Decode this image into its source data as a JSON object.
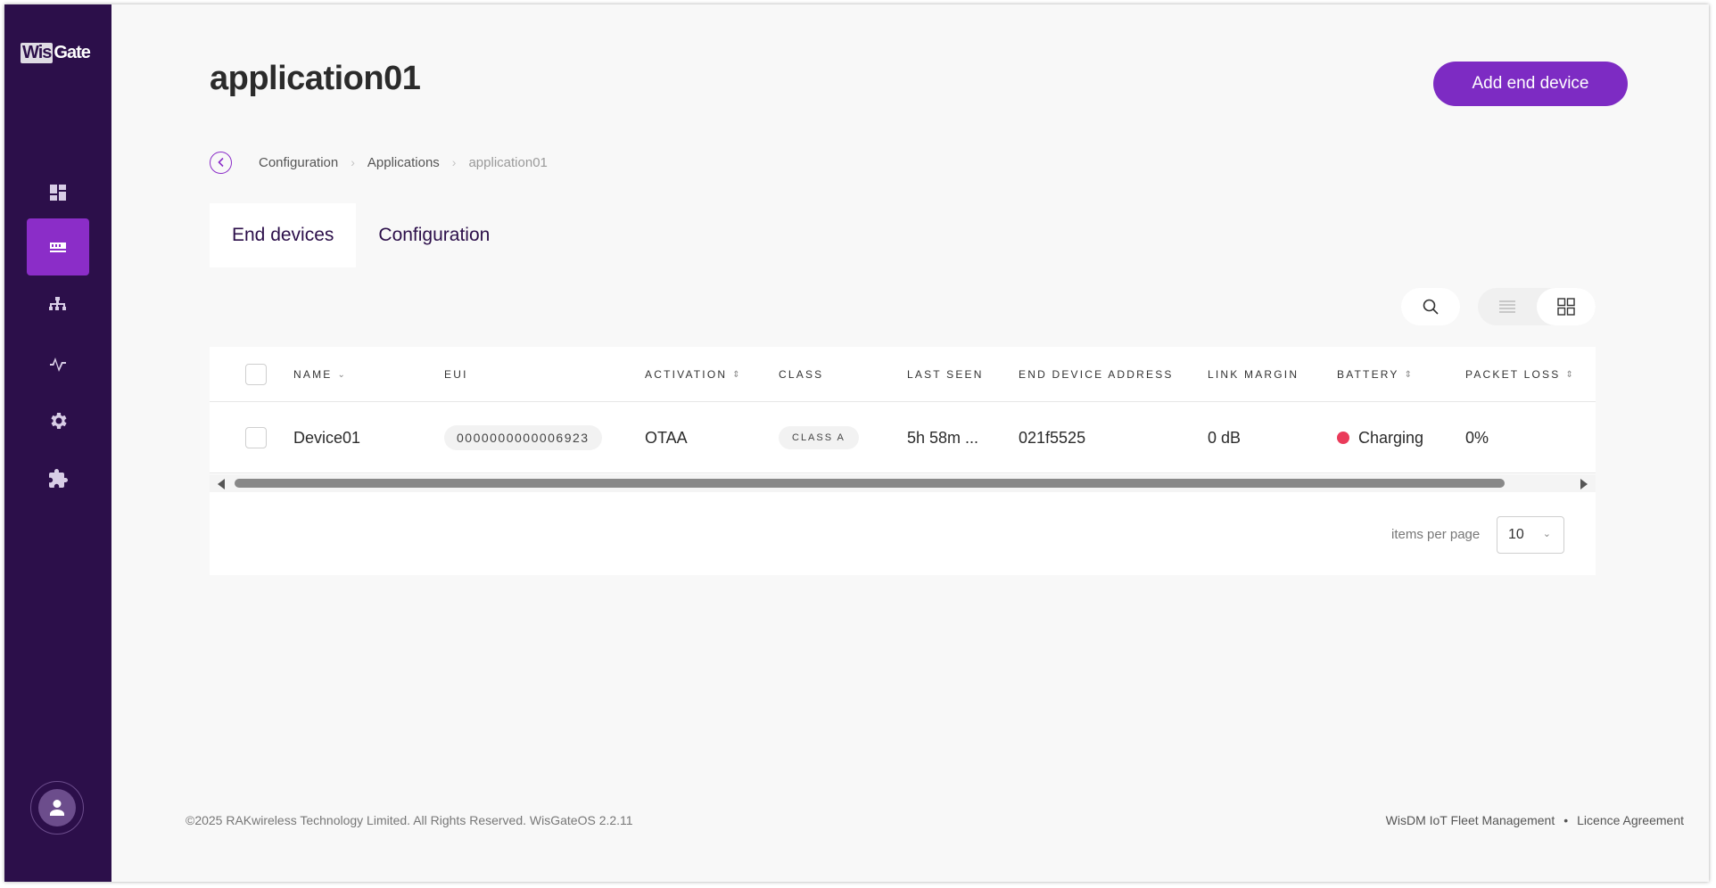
{
  "app": {
    "logo_part1": "Wis",
    "logo_part2": "Gate"
  },
  "sidebar": {
    "items": [
      {
        "icon": "dashboard-icon",
        "active": false
      },
      {
        "icon": "devices-icon",
        "active": true
      },
      {
        "icon": "network-icon",
        "active": false
      },
      {
        "icon": "activity-icon",
        "active": false
      },
      {
        "icon": "gear-icon",
        "active": false
      },
      {
        "icon": "puzzle-icon",
        "active": false
      }
    ],
    "avatar_icon": "user-icon"
  },
  "header": {
    "title": "application01",
    "add_button_label": "Add end device"
  },
  "breadcrumb": {
    "items": [
      "Configuration",
      "Applications",
      "application01"
    ]
  },
  "tabs": [
    {
      "label": "End devices",
      "active": true
    },
    {
      "label": "Configuration",
      "active": false
    }
  ],
  "table": {
    "columns": {
      "name": "NAME",
      "eui": "EUI",
      "activation": "ACTIVATION",
      "class": "CLASS",
      "last_seen": "LAST SEEN",
      "address": "END DEVICE ADDRESS",
      "link_margin": "LINK MARGIN",
      "battery": "BATTERY",
      "packet_loss": "PACKET LOSS"
    },
    "rows": [
      {
        "name": "Device01",
        "eui": "0000000000006923",
        "activation": "OTAA",
        "class": "CLASS A",
        "last_seen": "5h 58m ...",
        "address": "021f5525",
        "link_margin": "0 dB",
        "battery": "Charging",
        "battery_color": "#ea3b5a",
        "packet_loss": "0%"
      }
    ]
  },
  "pagination": {
    "label": "items per page",
    "value": "10"
  },
  "footer": {
    "copyright": "©2025 RAKwireless Technology Limited. All Rights Reserved. WisGateOS 2.2.11",
    "link1": "WisDM IoT Fleet Management",
    "separator": "•",
    "link2": "Licence Agreement"
  },
  "colors": {
    "sidebar_bg": "#2c0f4a",
    "accent": "#7d2bc3",
    "active_nav": "#8b2dc8"
  }
}
